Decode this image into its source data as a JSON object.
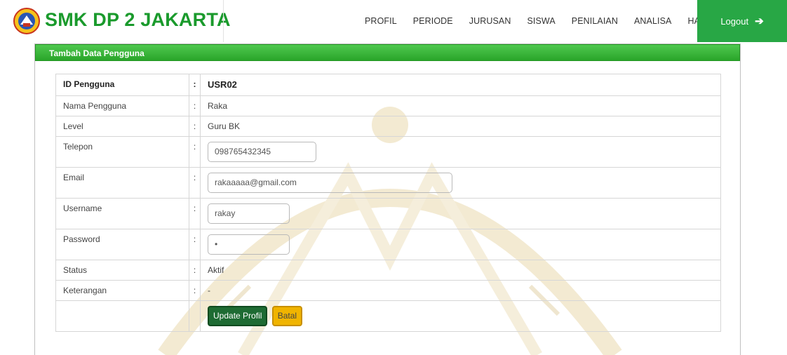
{
  "header": {
    "brand": "SMK DP 2 JAKARTA",
    "nav": [
      "PROFIL",
      "PERIODE",
      "JURUSAN",
      "SISWA",
      "PENILAIAN",
      "ANALISA",
      "HASIL"
    ],
    "logout_label": "Logout",
    "logout_icon": "arrow-right-icon"
  },
  "panel": {
    "title": "Tambah Data Pengguna"
  },
  "form": {
    "separator": ":",
    "id_label": "ID Pengguna",
    "id_value": "USR02",
    "nama_label": "Nama Pengguna",
    "nama_value": "Raka",
    "level_label": "Level",
    "level_value": "Guru BK",
    "telepon_label": "Telepon",
    "telepon_value": "098765432345",
    "email_label": "Email",
    "email_value": "rakaaaaa@gmail.com",
    "username_label": "Username",
    "username_value": "rakay",
    "password_label": "Password",
    "password_value": "•",
    "status_label": "Status",
    "status_value": "Aktif",
    "keterangan_label": "Keterangan",
    "keterangan_value": "-",
    "update_label": "Update Profil",
    "cancel_label": "Batal"
  },
  "colors": {
    "brand": "#1a9a2c",
    "logout_bg": "#28a745",
    "panel_header": "#2aa52a",
    "update_button": "#1e6b33",
    "cancel_button": "#f0b400"
  }
}
